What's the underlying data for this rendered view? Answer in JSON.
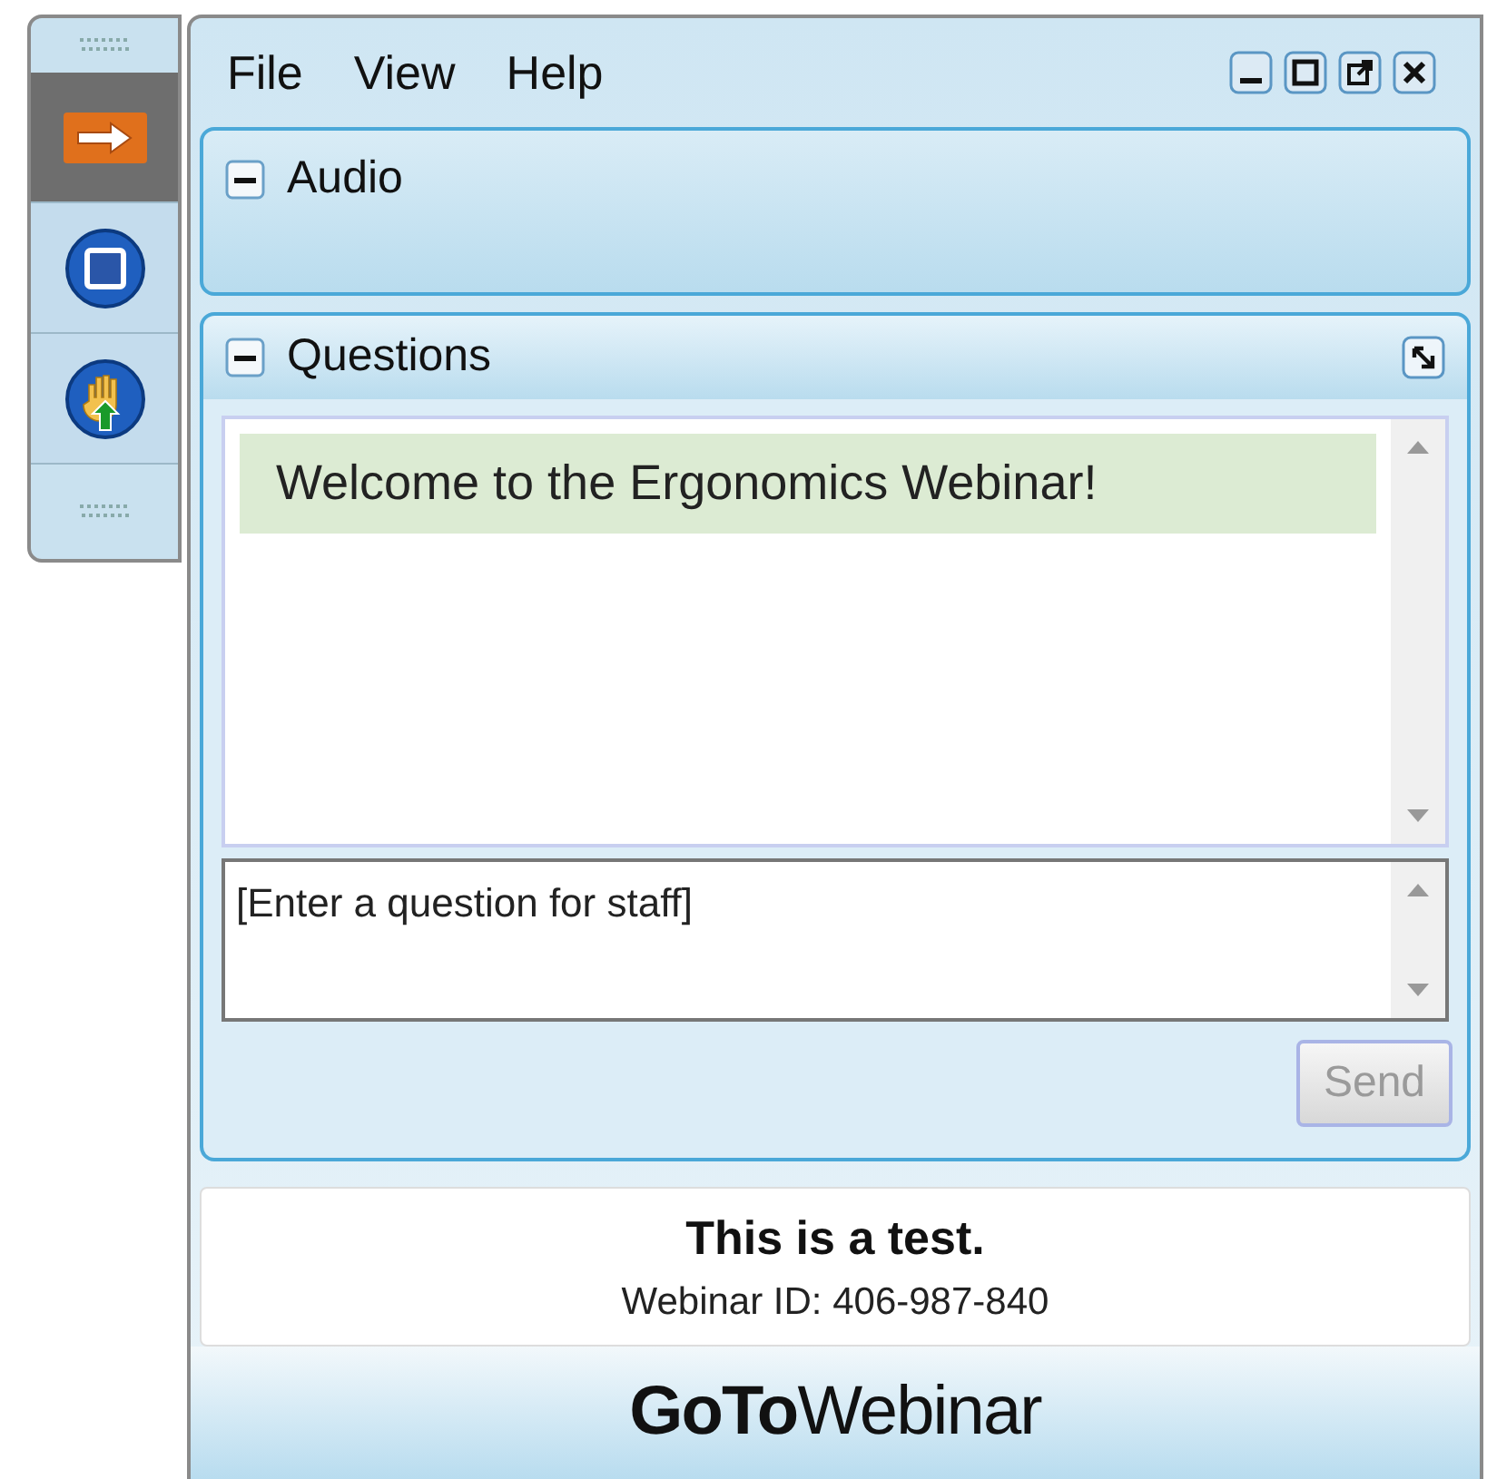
{
  "toolbar": {
    "buttons": [
      {
        "kind": "arrow",
        "selected": true
      },
      {
        "kind": "screen",
        "selected": false
      },
      {
        "kind": "hand",
        "selected": false
      }
    ]
  },
  "menu": [
    "File",
    "View",
    "Help"
  ],
  "audio": {
    "title": "Audio"
  },
  "questions": {
    "title": "Questions",
    "messages": [
      "Welcome to the Ergonomics Webinar!"
    ],
    "input": {
      "placeholder": "[Enter a question for staff]"
    },
    "send": {
      "label": "Send",
      "disabled": true
    }
  },
  "info": {
    "title": "This is a test.",
    "webinar_id": "Webinar ID: 406-987-840"
  },
  "logo": {
    "bold": "GoTo",
    "light": "Webinar"
  }
}
